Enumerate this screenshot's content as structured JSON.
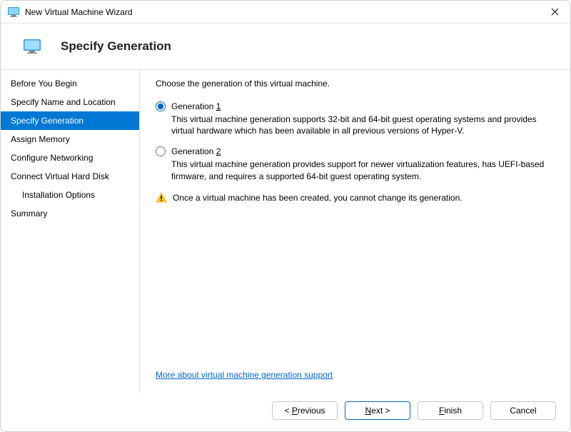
{
  "titlebar": {
    "title": "New Virtual Machine Wizard"
  },
  "header": {
    "title": "Specify Generation"
  },
  "sidebar": {
    "items": [
      {
        "label": "Before You Begin"
      },
      {
        "label": "Specify Name and Location"
      },
      {
        "label": "Specify Generation"
      },
      {
        "label": "Assign Memory"
      },
      {
        "label": "Configure Networking"
      },
      {
        "label": "Connect Virtual Hard Disk"
      },
      {
        "label": "Installation Options"
      },
      {
        "label": "Summary"
      }
    ],
    "selected_index": 2
  },
  "content": {
    "instruction": "Choose the generation of this virtual machine.",
    "options": [
      {
        "label_prefix": "Generation ",
        "mnemonic": "1",
        "label_suffix": "",
        "description": "This virtual machine generation supports 32-bit and 64-bit guest operating systems and provides virtual hardware which has been available in all previous versions of Hyper-V.",
        "selected": true
      },
      {
        "label_prefix": "Generation ",
        "mnemonic": "2",
        "label_suffix": "",
        "description": "This virtual machine generation provides support for newer virtualization features, has UEFI-based firmware, and requires a supported 64-bit guest operating system.",
        "selected": false
      }
    ],
    "warning": "Once a virtual machine has been created, you cannot change its generation.",
    "link": "More about virtual machine generation support"
  },
  "footer": {
    "previous_prefix": "< ",
    "previous_mnemonic": "P",
    "previous_suffix": "revious",
    "next_mnemonic": "N",
    "next_suffix": "ext >",
    "finish_mnemonic": "F",
    "finish_suffix": "inish",
    "cancel": "Cancel"
  }
}
